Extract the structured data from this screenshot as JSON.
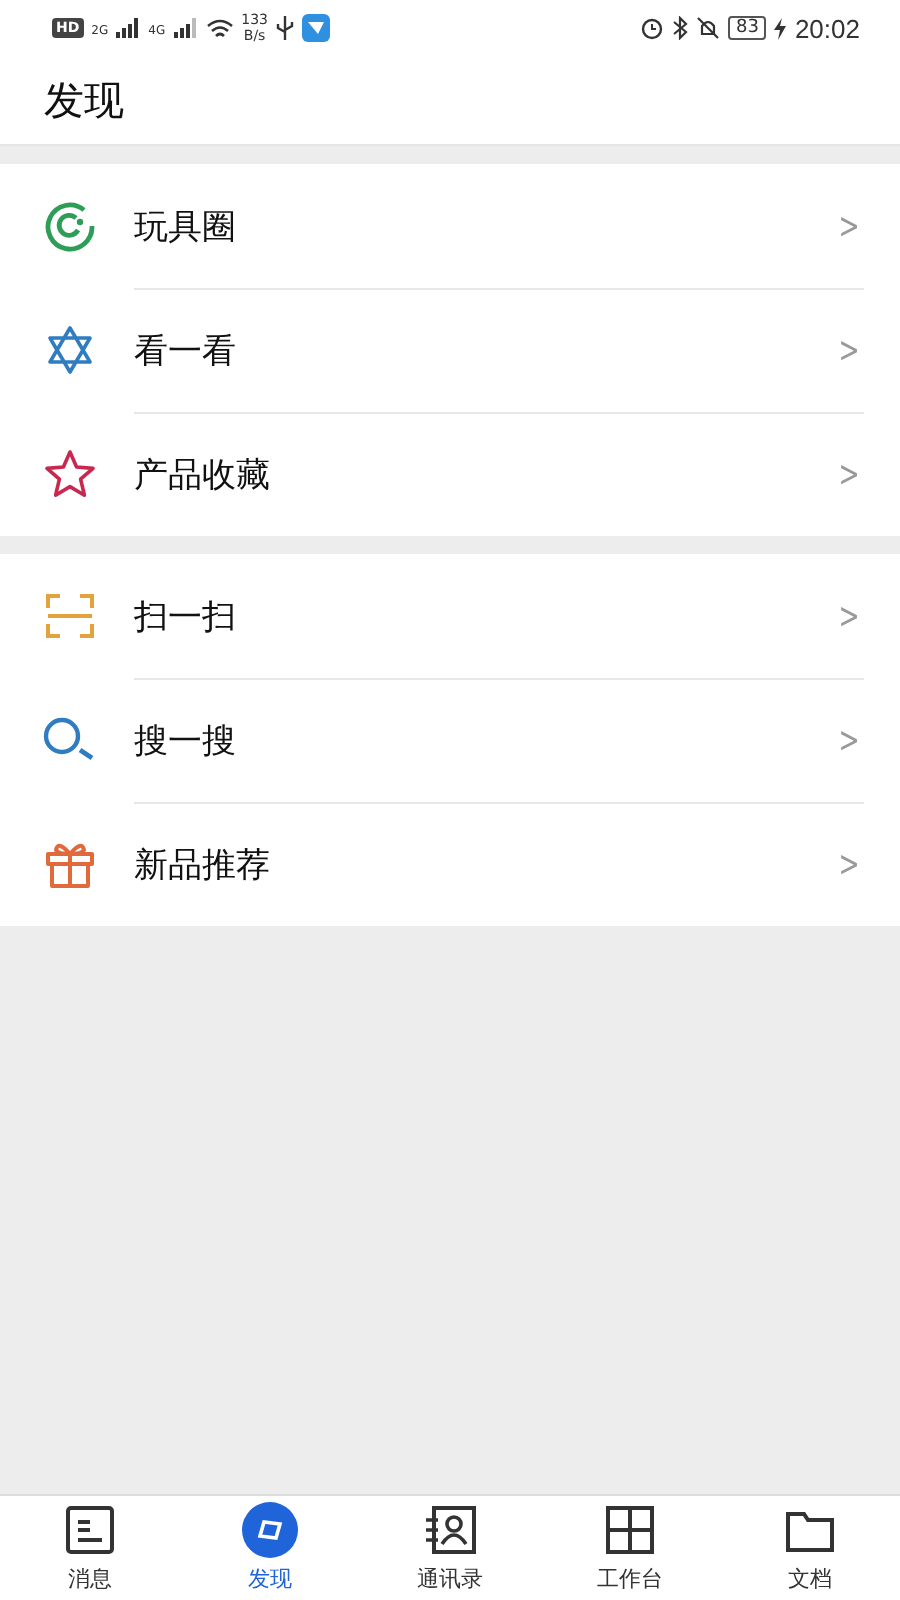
{
  "status_bar": {
    "hd": "HD",
    "sim1": "2G",
    "sim2": "4G",
    "speed_value": "133",
    "speed_unit": "B/s",
    "battery": "83",
    "time": "20:02"
  },
  "header": {
    "title": "发现"
  },
  "groups": [
    {
      "items": [
        {
          "kind": "circle",
          "label": "玩具圈",
          "chevron": ">"
        },
        {
          "kind": "hexagram",
          "label": "看一看",
          "chevron": ">"
        },
        {
          "kind": "star",
          "label": "产品收藏",
          "chevron": ">"
        }
      ]
    },
    {
      "items": [
        {
          "kind": "scan",
          "label": "扫一扫",
          "chevron": ">"
        },
        {
          "kind": "search",
          "label": "搜一搜",
          "chevron": ">"
        },
        {
          "kind": "gift",
          "label": "新品推荐",
          "chevron": ">"
        }
      ]
    }
  ],
  "tab_bar": [
    {
      "kind": "messages",
      "label": "消息",
      "selected": false
    },
    {
      "kind": "discover",
      "label": "发现",
      "selected": true
    },
    {
      "kind": "contacts",
      "label": "通讯录",
      "selected": false
    },
    {
      "kind": "workbench",
      "label": "工作台",
      "selected": false
    },
    {
      "kind": "docs",
      "label": "文档",
      "selected": false
    }
  ]
}
